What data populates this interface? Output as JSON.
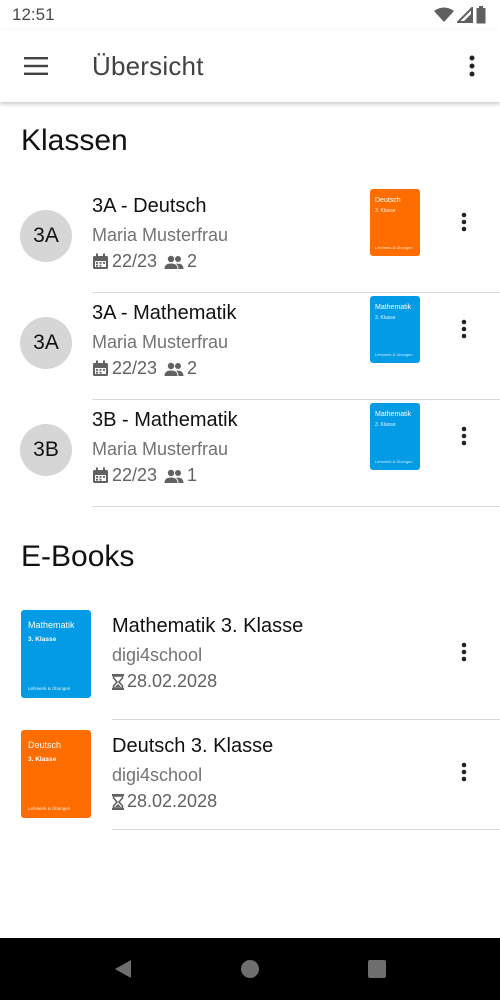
{
  "status_bar": {
    "time": "12:51"
  },
  "app_bar": {
    "title": "Übersicht"
  },
  "classes": {
    "heading": "Klassen",
    "items": [
      {
        "avatar": "3A",
        "title": "3A - Deutsch",
        "teacher": "Maria Musterfrau",
        "year": "22/23",
        "students": "2",
        "book": {
          "color": "#ff6d00",
          "title": "Deutsch",
          "subtitle": "3. Klasse",
          "footer": "Lehrwerk & Übungen"
        }
      },
      {
        "avatar": "3A",
        "title": "3A - Mathematik",
        "teacher": "Maria Musterfrau",
        "year": "22/23",
        "students": "2",
        "book": {
          "color": "#039be5",
          "title": "Mathematik",
          "subtitle": "3. Klasse",
          "footer": "Lehrwerk & Übungen"
        }
      },
      {
        "avatar": "3B",
        "title": "3B - Mathematik",
        "teacher": "Maria Musterfrau",
        "year": "22/23",
        "students": "1",
        "book": {
          "color": "#039be5",
          "title": "Mathematik",
          "subtitle": "3. Klasse",
          "footer": "Lehrwerk & Übungen"
        }
      }
    ]
  },
  "ebooks": {
    "heading": "E-Books",
    "items": [
      {
        "title": "Mathematik 3. Klasse",
        "publisher": "digi4school",
        "expiry": "28.02.2028",
        "cover": {
          "color": "#039be5",
          "title": "Mathematik",
          "subtitle": "3. Klasse",
          "footer": "Lehrwerk & Übungen"
        }
      },
      {
        "title": "Deutsch 3. Klasse",
        "publisher": "digi4school",
        "expiry": "28.02.2028",
        "cover": {
          "color": "#ff6d00",
          "title": "Deutsch",
          "subtitle": "3. Klasse",
          "footer": "Lehrwerk & Übungen"
        }
      }
    ]
  },
  "icons": {
    "menu": "menu-icon",
    "more": "more-vert-icon",
    "calendar": "calendar-icon",
    "people": "people-icon",
    "hourglass": "hourglass-icon",
    "wifi": "wifi-icon",
    "signal": "signal-icon",
    "battery": "battery-icon",
    "back": "back-triangle-icon",
    "home": "home-circle-icon",
    "recents": "recents-square-icon"
  },
  "colors": {
    "orange_book": "#ff6d00",
    "blue_book": "#039be5",
    "avatar_bg": "#d6d6d6"
  }
}
